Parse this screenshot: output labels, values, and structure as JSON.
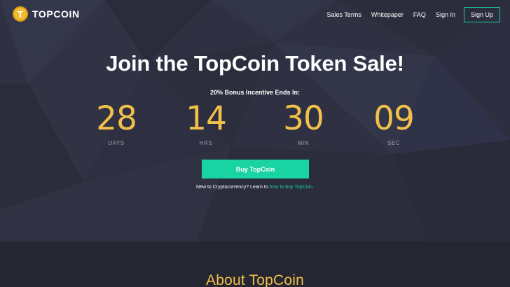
{
  "brand": {
    "logo_letter": "T",
    "name": "TOPCOIN",
    "accent": "#f3bb30"
  },
  "nav": {
    "links": [
      "Sales Terms",
      "Whitepaper",
      "FAQ",
      "Sign In"
    ],
    "signup": "Sign Up",
    "signup_border_color": "#19c9a2"
  },
  "hero": {
    "headline": "Join the TopCoin Token Sale!",
    "bonus_text": "20% Bonus Incentive Ends In:",
    "countdown": [
      {
        "value": "28",
        "label": "DAYS"
      },
      {
        "value": "14",
        "label": "HRS"
      },
      {
        "value": "30",
        "label": "MIN"
      },
      {
        "value": "09",
        "label": "SEC"
      }
    ],
    "countdown_color": "#f0c04a",
    "buy_button": "Buy TopCoin",
    "buy_button_color": "#19d3a2",
    "learn_prefix": "New to Cryptocurrency? Learn to ",
    "learn_link": "how to buy TopCoin."
  },
  "about": {
    "title": "About TopCoin"
  }
}
